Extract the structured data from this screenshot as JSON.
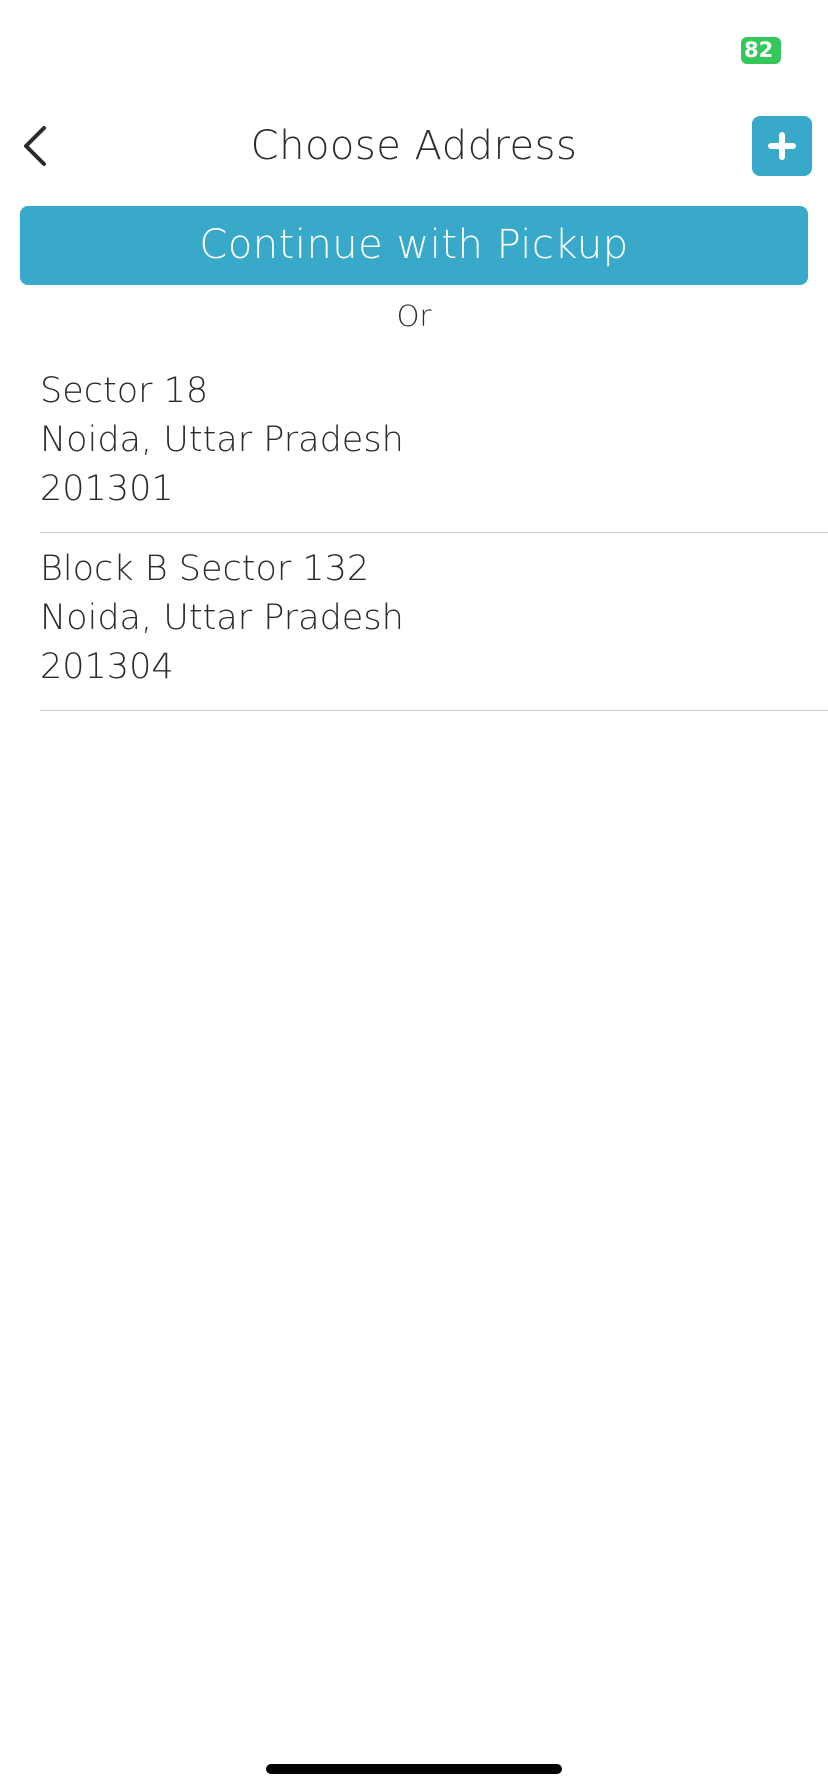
{
  "status_bar": {
    "battery_level": "82"
  },
  "nav": {
    "title": "Choose Address",
    "back_icon": "chevron-left-icon",
    "add_icon": "plus-icon"
  },
  "pickup_button_label": "Continue with Pickup",
  "or_label": "Or",
  "addresses": [
    {
      "line1": "Sector 18",
      "line2": "Noida, Uttar Pradesh",
      "line3": "201301"
    },
    {
      "line1": "Block B Sector 132",
      "line2": "Noida, Uttar Pradesh",
      "line3": "201304"
    }
  ],
  "colors": {
    "accent": "#38a9c9",
    "battery": "#34c759",
    "text": "#2b2b2b",
    "divider": "#cfcfcf"
  }
}
